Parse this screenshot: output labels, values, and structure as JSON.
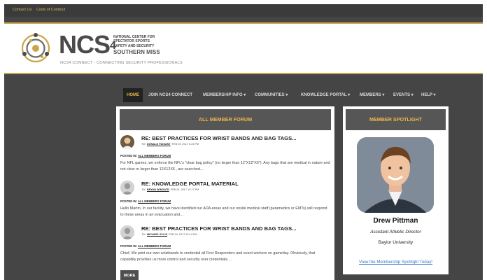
{
  "topbar": {
    "links": [
      "Contact Us",
      "Code of Conduct"
    ]
  },
  "header": {
    "logo_text": "NCS",
    "logo_superscript": "4",
    "org_lines": [
      "NATIONAL CENTER FOR",
      "SPECTATOR SPORTS",
      "SAFETY AND SECURITY"
    ],
    "school": "SOUTHERN MISS",
    "tagline": "NCS4 CONNECT - CONNECTING SECURITY PROFESSIONALS"
  },
  "nav": {
    "items": [
      {
        "label": "HOME"
      },
      {
        "label": "JOIN NCS4 CONNECT"
      },
      {
        "label": "MEMBERSHIP INFO ▾"
      },
      {
        "label": "COMMUNITIES ▾"
      },
      {
        "label": "KNOWLEDGE PORTAL ▾"
      },
      {
        "label": "MEMBERS ▾"
      },
      {
        "label": "EVENTS ▾"
      },
      {
        "label": "HELP ▾"
      }
    ]
  },
  "forum": {
    "heading": "ALL MEMBER FORUM",
    "posted_in_label": "POSTED IN:",
    "by_label": "BY:",
    "posts": [
      {
        "title": "RE: BEST PRACTICES FOR WRIST BANDS AND BAG TAGS...",
        "author": "DONALD PAISANT",
        "date": ", FEB 25, 2017 6:24 PM",
        "forum": "ALL MEMBERS FORUM",
        "body": "For NFL games, we enforce the NFL's \"clear bag policy\" (no larger than 12\"X12\"X6\"). Any bags that are medical in nature and not clear or larger than 12X12X6 , are searched..."
      },
      {
        "title": "RE: KNOWLEDGE PORTAL MATERIAL",
        "author": "BRYAN WINGATE",
        "date": ", FEB 24, 2017 12:17 PM",
        "forum": "ALL MEMBERS FORUM",
        "body": "Hello Martin, In our facility, we have identified our ADA areas and our onsite medical staff (paramedics or EMTs) will respond to these areas in an evacuation and..."
      },
      {
        "title": "RE: BEST PRACTICES FOR WRIST BANDS AND BAG TAGS...",
        "author": "MICHAEL ELLIS",
        "date": ", FEB 24, 2017 12:14 PM",
        "forum": "ALL MEMBERS FORUM",
        "body": "Chief, We print our own wristbands to credential all First Responders and event workers on gameday. Obviously, that capability provides us more control and security over credentials...."
      }
    ],
    "more_label": "MORE"
  },
  "spotlight": {
    "heading": "MEMBER SPOTLIGHT",
    "name": "Drew Pittman",
    "title": "Assistant Athletic Director",
    "organization": "Baylor University",
    "link": "View the Membership Spotlight Today!"
  },
  "colors": {
    "page_bg": "#454545",
    "accent_gold": "#c9a64a",
    "panel_heading_bg": "#565656",
    "panel_heading_text": "#f0b64a",
    "link_blue": "#3a79c9"
  }
}
